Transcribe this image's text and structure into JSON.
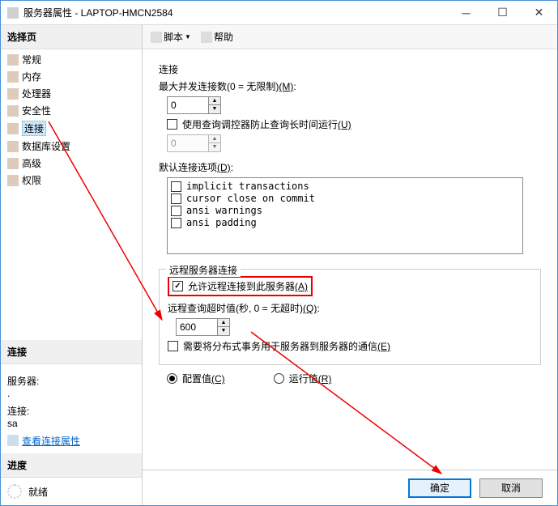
{
  "title": "服务器属性 - LAPTOP-HMCN2584",
  "sidebar": {
    "header": "选择页",
    "items": [
      {
        "label": "常规"
      },
      {
        "label": "内存"
      },
      {
        "label": "处理器"
      },
      {
        "label": "安全性"
      },
      {
        "label": "连接"
      },
      {
        "label": "数据库设置"
      },
      {
        "label": "高级"
      },
      {
        "label": "权限"
      }
    ],
    "conn_header": "连接",
    "server_label": "服务器:",
    "server_value": ".",
    "conn_label": "连接:",
    "conn_value": "sa",
    "view_props": "查看连接属性",
    "progress_header": "进度",
    "ready": "就绪"
  },
  "toolbar": {
    "script": "脚本",
    "help": "帮助"
  },
  "main": {
    "conn_group": "连接",
    "max_conn_label": "最大并发连接数(0 = 无限制)",
    "max_conn_hotkey": "(M)",
    "max_conn_value": "0",
    "use_governor": "使用查询调控器防止查询长时间运行",
    "use_governor_hotkey": "(U)",
    "governor_value": "0",
    "default_opts_label": "默认连接选项",
    "default_opts_hotkey": "(D)",
    "options": [
      "implicit transactions",
      "cursor close on commit",
      "ansi warnings",
      "ansi padding"
    ],
    "remote_group": "远程服务器连接",
    "allow_remote": "允许远程连接到此服务器",
    "allow_remote_hotkey": "(A)",
    "remote_timeout_label": "远程查询超时值(秒, 0 = 无超时)",
    "remote_timeout_hotkey": "(Q)",
    "remote_timeout_value": "600",
    "dist_tx": "需要将分布式事务用于服务器到服务器的通信",
    "dist_tx_hotkey": "(E)",
    "config_value": "配置值",
    "config_hotkey": "(C)",
    "run_value": "运行值",
    "run_hotkey": "(R)"
  },
  "footer": {
    "ok": "确定",
    "cancel": "取消"
  }
}
